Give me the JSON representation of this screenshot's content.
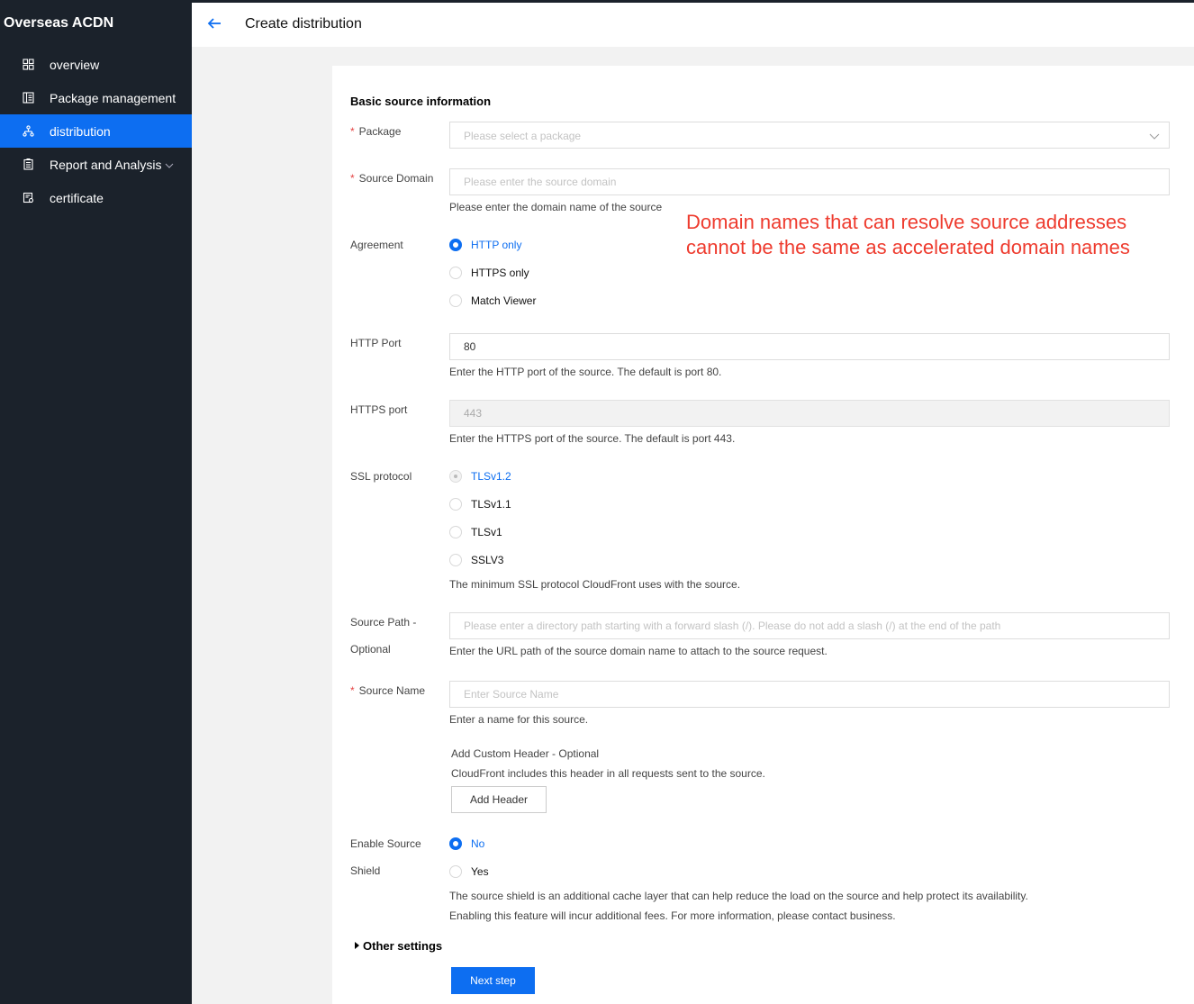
{
  "sidebar": {
    "brand": "Overseas ACDN",
    "items": [
      {
        "label": "overview",
        "icon": "grid-icon"
      },
      {
        "label": "Package management",
        "icon": "package-icon"
      },
      {
        "label": "distribution",
        "icon": "distribution-icon",
        "active": true
      },
      {
        "label": "Report and Analysis",
        "icon": "report-icon",
        "has_submenu": true
      },
      {
        "label": "certificate",
        "icon": "certificate-icon"
      }
    ]
  },
  "header": {
    "title": "Create distribution"
  },
  "form": {
    "section_title": "Basic source information",
    "package": {
      "label": "Package",
      "placeholder": "Please select a package"
    },
    "source_domain": {
      "label": "Source Domain",
      "placeholder": "Please enter the source domain",
      "hint": "Please enter the domain name of the source"
    },
    "agreement": {
      "label": "Agreement",
      "options": [
        "HTTP only",
        "HTTPS only",
        "Match Viewer"
      ],
      "selected": "HTTP only"
    },
    "http_port": {
      "label": "HTTP Port",
      "value": "80",
      "hint": "Enter the HTTP port of the source. The default is port 80."
    },
    "https_port": {
      "label": "HTTPS port",
      "value": "443",
      "hint": "Enter the HTTPS port of the source. The default is port 443."
    },
    "ssl_protocol": {
      "label": "SSL protocol",
      "options": [
        "TLSv1.2",
        "TLSv1.1",
        "TLSv1",
        "SSLV3"
      ],
      "selected": "TLSv1.2",
      "hint": "The minimum SSL protocol CloudFront uses with the source."
    },
    "source_path": {
      "label_line1": "Source Path -",
      "label_line2": "Optional",
      "placeholder": "Please enter a directory path starting with a forward slash (/). Please do not add a slash (/) at the end of the path",
      "hint": "Enter the URL path of the source domain name to attach to the source request."
    },
    "source_name": {
      "label": "Source Name",
      "placeholder": "Enter Source Name",
      "hint": "Enter a name for this source."
    },
    "custom_header": {
      "title": "Add Custom Header - Optional",
      "hint": "CloudFront includes this header in all requests sent to the source.",
      "button": "Add Header"
    },
    "source_shield": {
      "label_line1": "Enable Source",
      "label_line2": "Shield",
      "options": [
        "No",
        "Yes"
      ],
      "selected": "No",
      "hint_line1": "The source shield is an additional cache layer that can help reduce the load on the source and help protect its availability.",
      "hint_line2": "Enabling this feature will incur additional fees. For more information, please contact business."
    },
    "other_settings": "Other settings",
    "next_button": "Next step"
  },
  "annotation": {
    "line1": "Domain names that can resolve source addresses",
    "line2": "cannot be the same as accelerated domain names",
    "color": "#ee3b2e"
  },
  "colors": {
    "sidebar_bg": "#1b222b",
    "accent": "#0d6ef1",
    "required": "#e54545"
  }
}
